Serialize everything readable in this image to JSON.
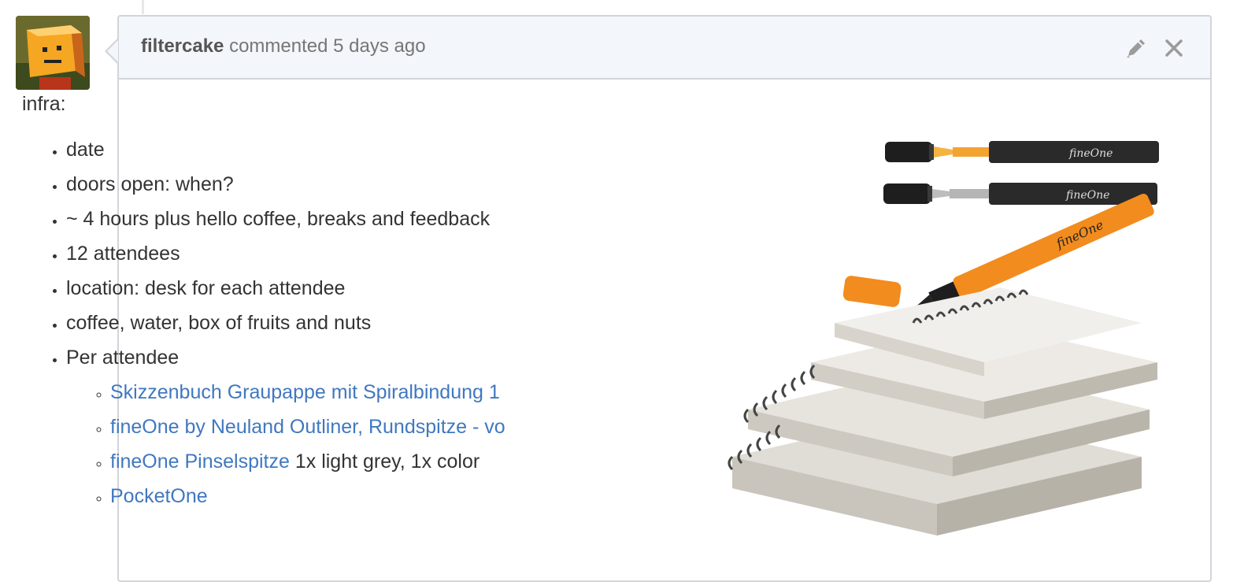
{
  "comment": {
    "author": "filtercake",
    "action": "commented",
    "time": "5 days ago",
    "edit_icon": "pencil-icon",
    "close_icon": "close-icon"
  },
  "body": {
    "intro": "infra:",
    "items": [
      "date",
      "doors open: when?",
      "~ 4 hours plus hello coffee, breaks and feedback",
      "12 attendees",
      "location: desk for each attendee",
      "coffee, water, box of fruits and nuts",
      "Per attendee"
    ],
    "sub_items": [
      {
        "link": "Skizzenbuch Graupappe mit Spiralbindung 1",
        "text": ""
      },
      {
        "link": "fineOne by Neuland Outliner, Rundspitze - vo",
        "text": ""
      },
      {
        "link": "fineOne Pinselspitze",
        "text": " 1x light grey, 1x color"
      },
      {
        "link": "PocketOne",
        "text": ""
      }
    ]
  },
  "image_labels": {
    "pen_brand_1": "fineOne",
    "pen_brand_2": "fineOne",
    "pen_brand_3": "fineOne"
  },
  "colors": {
    "link": "#4078c0",
    "header_bg": "#f3f6fa",
    "border": "#d1d5da",
    "orange": "#f28c1e"
  }
}
